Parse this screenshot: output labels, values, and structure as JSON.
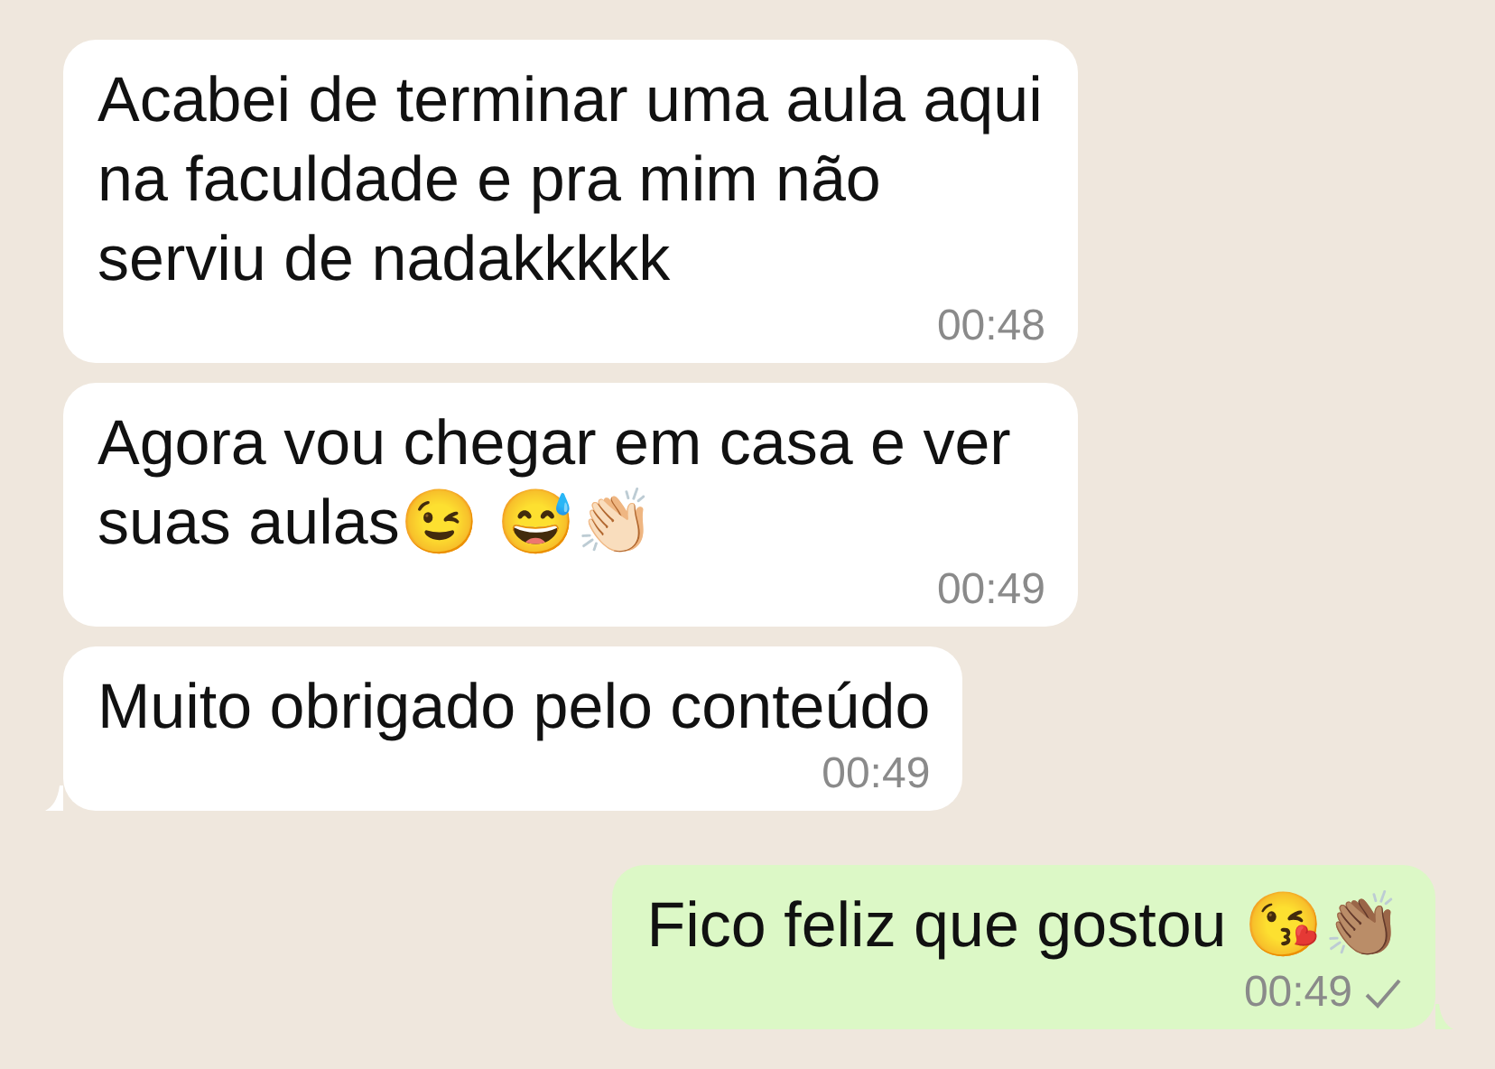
{
  "messages": [
    {
      "kind": "incoming",
      "text": "Acabei de terminar uma aula aqui na faculdade e pra mim não serviu de nadakkkkk",
      "time": "00:48",
      "tail": false
    },
    {
      "kind": "incoming",
      "text": "Agora vou chegar em casa e ver suas aulas😉 😅👏🏻",
      "time": "00:49",
      "tail": false
    },
    {
      "kind": "incoming",
      "text": "Muito obrigado pelo conteúdo",
      "time": "00:49",
      "tail": true
    },
    {
      "kind": "outgoing",
      "text": "Fico feliz que gostou 😘👏🏽",
      "time": "00:49",
      "tail": true,
      "sent": true
    }
  ]
}
